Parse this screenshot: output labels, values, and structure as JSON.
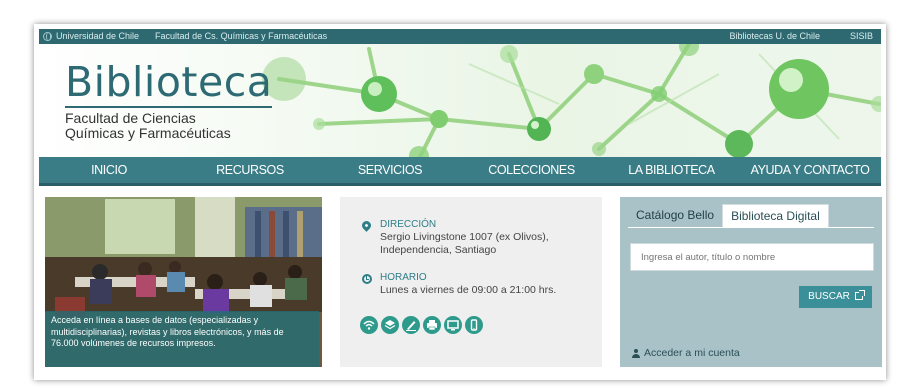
{
  "topbar": {
    "left_links": [
      "Universidad de Chile",
      "Facultad de Cs. Químicas y Farmacéuticas"
    ],
    "right_links": [
      "Bibliotecas U. de Chile",
      "SISIB"
    ]
  },
  "banner": {
    "title": "Biblioteca",
    "subtitle_line1": "Facultad de Ciencias",
    "subtitle_line2": "Químicas y Farmacéuticas"
  },
  "nav": {
    "items": [
      "INICIO",
      "RECURSOS",
      "SERVICIOS",
      "COLECCIONES",
      "LA BIBLIOTECA",
      "AYUDA Y CONTACTO"
    ]
  },
  "photo": {
    "caption": "Acceda en línea a bases de datos (especializadas y multidisciplinarias), revistas y libros electrónicos, y más de 76.000 volúmenes de recursos impresos."
  },
  "info": {
    "address_label": "DIRECCIÓN",
    "address_line1": "Sergio Livingstone 1007 (ex Olivos),",
    "address_line2": "Independencia, Santiago",
    "hours_label": "HORARIO",
    "hours_value": "Lunes a viernes de 09:00 a 21:00 hrs.",
    "service_icons": [
      "wifi-icon",
      "layers-icon",
      "pen-icon",
      "printer-icon",
      "monitor-icon",
      "mobile-icon"
    ]
  },
  "catalog": {
    "tabs": [
      "Catálogo Bello",
      "Biblioteca Digital"
    ],
    "search_placeholder": "Ingresa el autor, título o nombre",
    "search_button": "BUSCAR",
    "account_link": "Acceder a mi cuenta"
  },
  "colors": {
    "primary": "#3a7d87",
    "topbar": "#2e6870",
    "panel": "#a9c2c8",
    "accent_green": "#2e9a8b"
  }
}
